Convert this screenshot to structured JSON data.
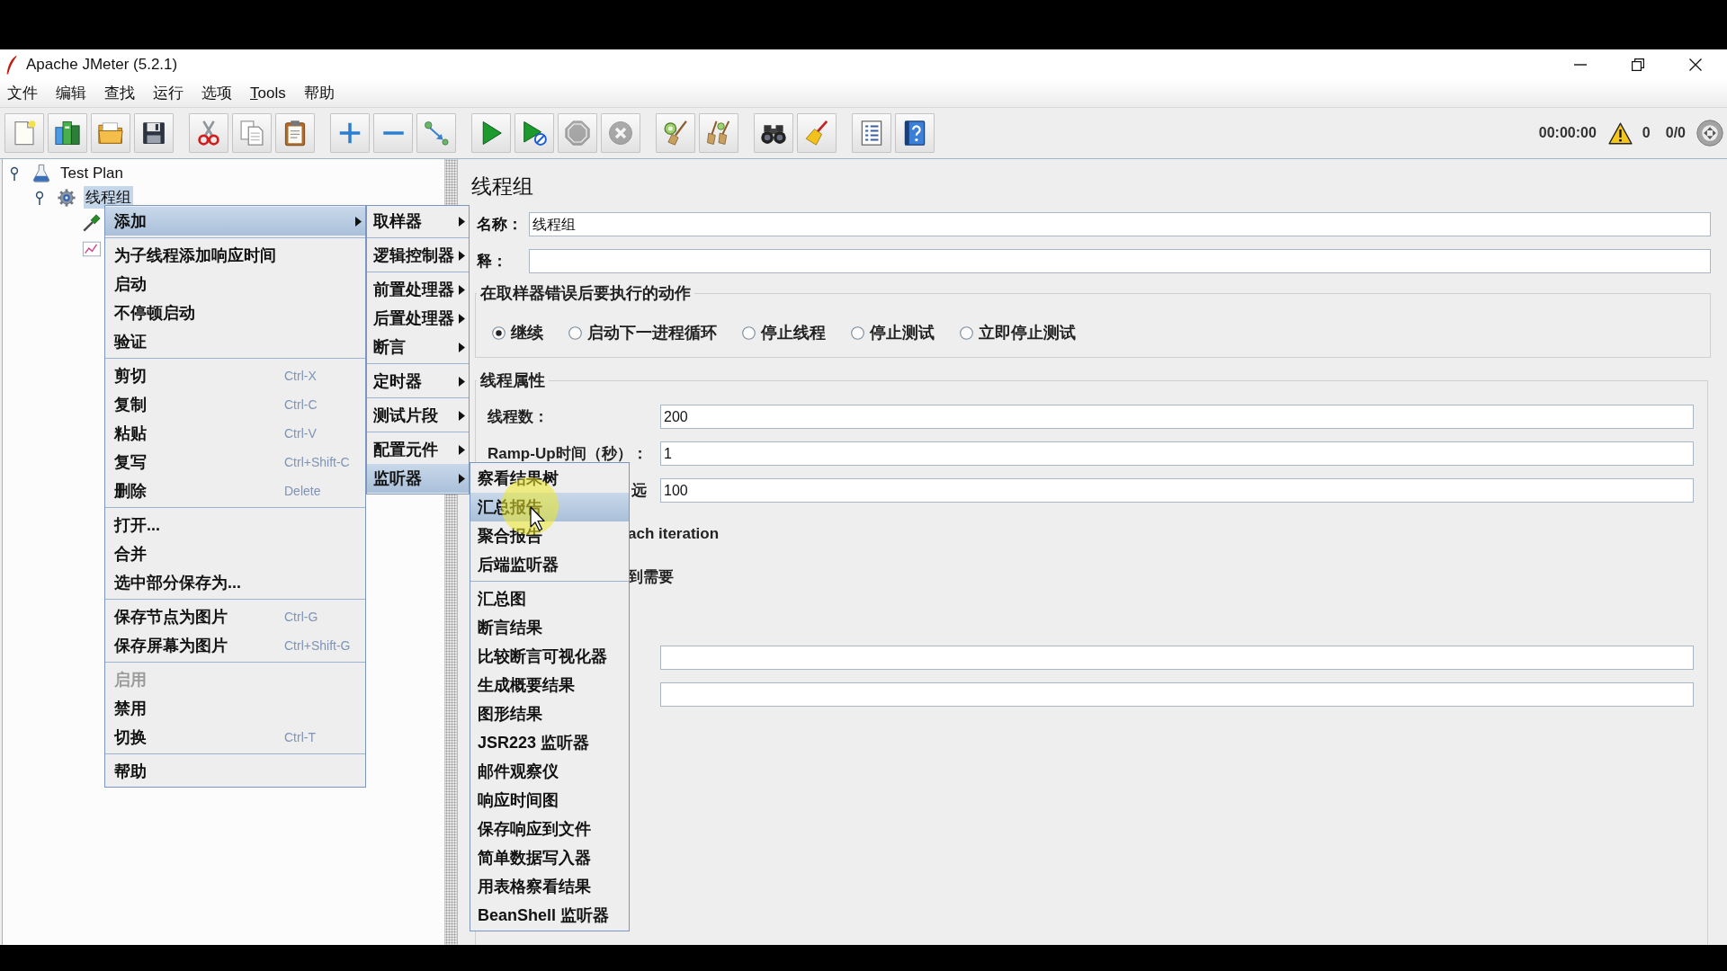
{
  "window": {
    "title": "Apache JMeter (5.2.1)"
  },
  "menu_bar": [
    {
      "label": "文件",
      "mnemonic": false
    },
    {
      "label": "编辑",
      "mnemonic": false
    },
    {
      "label": "查找",
      "mnemonic": false
    },
    {
      "label": "运行",
      "mnemonic": false
    },
    {
      "label": "选项",
      "mnemonic": false
    },
    {
      "label": "Tools",
      "mnemonic": true
    },
    {
      "label": "帮助",
      "mnemonic": false
    }
  ],
  "toolbar": {
    "groups": [
      [
        {
          "kind": "new",
          "disabled": false
        },
        {
          "kind": "templates",
          "disabled": false
        },
        {
          "kind": "open",
          "disabled": false
        },
        {
          "kind": "save",
          "disabled": false
        }
      ],
      [
        {
          "kind": "cut",
          "disabled": false
        },
        {
          "kind": "copy",
          "disabled": false
        },
        {
          "kind": "paste",
          "disabled": false
        }
      ],
      [
        {
          "kind": "expand",
          "disabled": false
        },
        {
          "kind": "collapse",
          "disabled": false
        },
        {
          "kind": "toggle",
          "disabled": false
        }
      ],
      [
        {
          "kind": "start",
          "disabled": false
        },
        {
          "kind": "startnopause",
          "disabled": false
        },
        {
          "kind": "stop",
          "disabled": true
        },
        {
          "kind": "shutdown",
          "disabled": true
        }
      ],
      [
        {
          "kind": "clear",
          "disabled": false
        },
        {
          "kind": "clearall",
          "disabled": false
        }
      ],
      [
        {
          "kind": "search",
          "disabled": false
        },
        {
          "kind": "reset",
          "disabled": false
        }
      ],
      [
        {
          "kind": "functions",
          "disabled": false
        },
        {
          "kind": "help",
          "disabled": false
        }
      ]
    ]
  },
  "status": {
    "elapsed": "00:00:00",
    "errors": "0",
    "threads": "0/0"
  },
  "tree": [
    {
      "label": "Test Plan",
      "kind": "plan",
      "expanded": true,
      "selected": false,
      "children": [
        {
          "label": "线程组",
          "kind": "threadgroup",
          "expanded": true,
          "selected": true,
          "children": [
            {
              "kind": "sampler",
              "selected": false
            },
            {
              "kind": "listener",
              "selected": false
            }
          ]
        }
      ]
    }
  ],
  "context_menu": {
    "groups": [
      [
        {
          "label": "添加",
          "submenu": true,
          "selected": true,
          "disabled": false
        }
      ],
      [
        {
          "label": "为子线程添加响应时间",
          "submenu": false,
          "selected": false,
          "disabled": false
        },
        {
          "label": "启动",
          "submenu": false,
          "selected": false,
          "disabled": false
        },
        {
          "label": "不停顿启动",
          "submenu": false,
          "selected": false,
          "disabled": false
        },
        {
          "label": "验证",
          "submenu": false,
          "selected": false,
          "disabled": false
        }
      ],
      [
        {
          "label": "剪切",
          "shortcut": "Ctrl-X",
          "submenu": false,
          "selected": false,
          "disabled": false
        },
        {
          "label": "复制",
          "shortcut": "Ctrl-C",
          "submenu": false,
          "selected": false,
          "disabled": false
        },
        {
          "label": "粘贴",
          "shortcut": "Ctrl-V",
          "submenu": false,
          "selected": false,
          "disabled": false
        },
        {
          "label": "复写",
          "shortcut": "Ctrl+Shift-C",
          "submenu": false,
          "selected": false,
          "disabled": false
        },
        {
          "label": "删除",
          "shortcut": "Delete",
          "submenu": false,
          "selected": false,
          "disabled": false
        }
      ],
      [
        {
          "label": "打开...",
          "submenu": false,
          "selected": false,
          "disabled": false
        },
        {
          "label": "合并",
          "submenu": false,
          "selected": false,
          "disabled": false
        },
        {
          "label": "选中部分保存为...",
          "submenu": false,
          "selected": false,
          "disabled": false
        }
      ],
      [
        {
          "label": "保存节点为图片",
          "shortcut": "Ctrl-G",
          "submenu": false,
          "selected": false,
          "disabled": false
        },
        {
          "label": "保存屏幕为图片",
          "shortcut": "Ctrl+Shift-G",
          "submenu": false,
          "selected": false,
          "disabled": false
        }
      ],
      [
        {
          "label": "启用",
          "submenu": false,
          "selected": false,
          "disabled": true
        },
        {
          "label": "禁用",
          "submenu": false,
          "selected": false,
          "disabled": false
        },
        {
          "label": "切换",
          "shortcut": "Ctrl-T",
          "submenu": false,
          "selected": false,
          "disabled": false
        }
      ],
      [
        {
          "label": "帮助",
          "submenu": false,
          "selected": false,
          "disabled": false
        }
      ]
    ]
  },
  "add_submenu": {
    "groups": [
      [
        {
          "label": "取样器",
          "submenu": true,
          "selected": false
        }
      ],
      [
        {
          "label": "逻辑控制器",
          "submenu": true,
          "selected": false
        }
      ],
      [
        {
          "label": "前置处理器",
          "submenu": true,
          "selected": false
        },
        {
          "label": "后置处理器",
          "submenu": true,
          "selected": false
        },
        {
          "label": "断言",
          "submenu": true,
          "selected": false
        }
      ],
      [
        {
          "label": "定时器",
          "submenu": true,
          "selected": false
        }
      ],
      [
        {
          "label": "测试片段",
          "submenu": true,
          "selected": false
        }
      ],
      [
        {
          "label": "配置元件",
          "submenu": true,
          "selected": false
        },
        {
          "label": "监听器",
          "submenu": true,
          "selected": true
        }
      ]
    ]
  },
  "listener_submenu": {
    "groups": [
      [
        {
          "label": "察看结果树",
          "selected": false
        },
        {
          "label": "汇总报告",
          "selected": true
        },
        {
          "label": "聚合报告",
          "selected": false
        },
        {
          "label": "后端监听器",
          "selected": false
        }
      ],
      [
        {
          "label": "汇总图",
          "selected": false
        },
        {
          "label": "断言结果",
          "selected": false
        },
        {
          "label": "比较断言可视化器",
          "selected": false
        },
        {
          "label": "生成概要结果",
          "selected": false
        },
        {
          "label": "图形结果",
          "selected": false
        },
        {
          "label": "JSR223 监听器",
          "selected": false
        },
        {
          "label": "邮件观察仪",
          "selected": false
        },
        {
          "label": "响应时间图",
          "selected": false
        },
        {
          "label": "保存响应到文件",
          "selected": false
        },
        {
          "label": "简单数据写入器",
          "selected": false
        },
        {
          "label": "用表格察看结果",
          "selected": false
        },
        {
          "label": "BeanShell 监听器",
          "selected": false
        }
      ]
    ]
  },
  "editor": {
    "title": "线程组",
    "name": {
      "label": "名称：",
      "value": "线程组"
    },
    "comment": {
      "label": "释："
    },
    "error_action": {
      "title": "在取样器错误后要执行的动作",
      "options": [
        {
          "label": "继续",
          "selected": true
        },
        {
          "label": "启动下一进程循环",
          "selected": false
        },
        {
          "label": "停止线程",
          "selected": false
        },
        {
          "label": "停止测试",
          "selected": false
        },
        {
          "label": "立即停止测试",
          "selected": false
        }
      ]
    },
    "thread_properties": {
      "title": "线程属性",
      "rows": [
        {
          "kind": "field",
          "label": "线程数：",
          "value": "200"
        },
        {
          "kind": "field",
          "label": "Ramp-Up时间（秒）：",
          "value": "1"
        },
        {
          "kind": "clipped",
          "label": "远",
          "value": "100"
        },
        {
          "kind": "text",
          "label": "ach iteration"
        },
        {
          "kind": "text",
          "label": "到需要"
        },
        {
          "kind": "field"
        },
        {
          "kind": "field"
        }
      ]
    }
  }
}
